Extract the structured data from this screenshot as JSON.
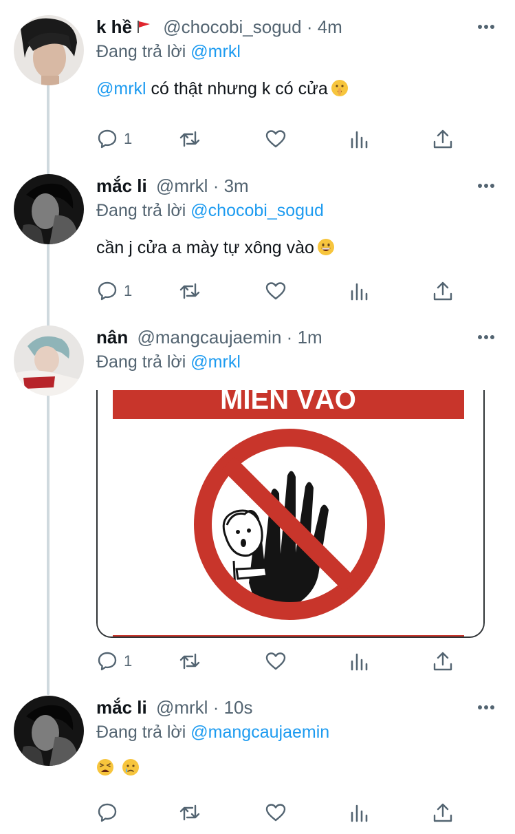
{
  "tweets": [
    {
      "name": "k hề",
      "handle": "@chocobi_sogud",
      "sep": "·",
      "time": "4m",
      "reply_prefix": "Đang trả lời",
      "reply_to": "@mrkl",
      "mention": "@mrkl",
      "text": "có thật nhưng k có cửa",
      "reply_count": "1"
    },
    {
      "name": "mắc li",
      "handle": "@mrkl",
      "sep": "·",
      "time": "3m",
      "reply_prefix": "Đang trả lời",
      "reply_to": "@chocobi_sogud",
      "text": "cần j cửa a mày tự xông vào",
      "reply_count": "1"
    },
    {
      "name": "nân",
      "handle": "@mangcaujaemin",
      "sep": "·",
      "time": "1m",
      "reply_prefix": "Đang trả lời",
      "reply_to": "@mrkl",
      "image_sign_text": "MIỄN VÀO",
      "reply_count": "1"
    },
    {
      "name": "mắc li",
      "handle": "@mrkl",
      "sep": "·",
      "time": "10s",
      "reply_prefix": "Đang trả lời",
      "reply_to": "@mangcaujaemin",
      "reply_count": ""
    }
  ],
  "icons": [
    "reply-icon",
    "retweet-icon",
    "like-icon",
    "analytics-icon",
    "share-icon",
    "more-icon"
  ],
  "colors": {
    "link": "#1d9bf0",
    "secondary": "#536471",
    "thread_line": "#cfd9de",
    "sign_red": "#c8352b"
  }
}
